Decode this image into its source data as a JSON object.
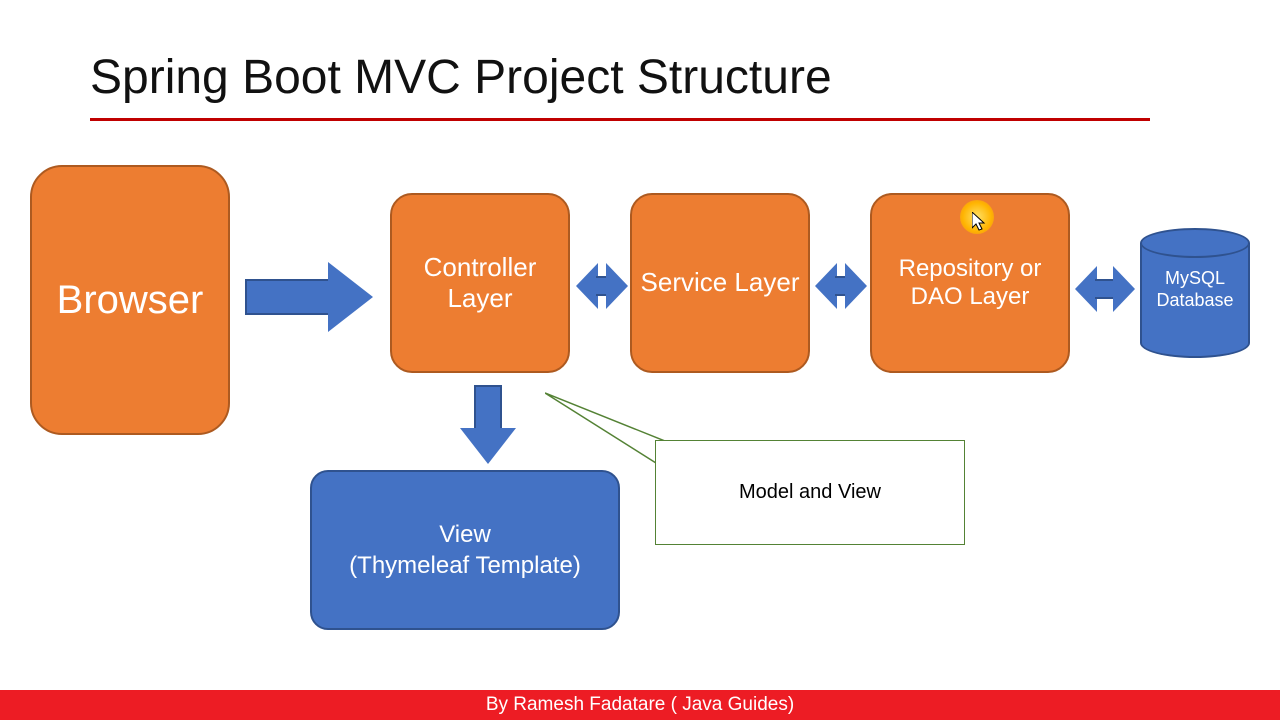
{
  "title": "Spring Boot MVC Project Structure",
  "boxes": {
    "browser": "Browser",
    "controller": "Controller Layer",
    "service": "Service Layer",
    "repository": "Repository or DAO Layer",
    "view": "View\n(Thymeleaf Template)",
    "database": "MySQL Database"
  },
  "callout": "Model and View",
  "footer": "By Ramesh Fadatare ( Java Guides)",
  "colors": {
    "orange": "#ed7d31",
    "blue": "#4472c4",
    "red": "#ed1c24",
    "titleRule": "#c00000",
    "calloutBorder": "#548235"
  }
}
